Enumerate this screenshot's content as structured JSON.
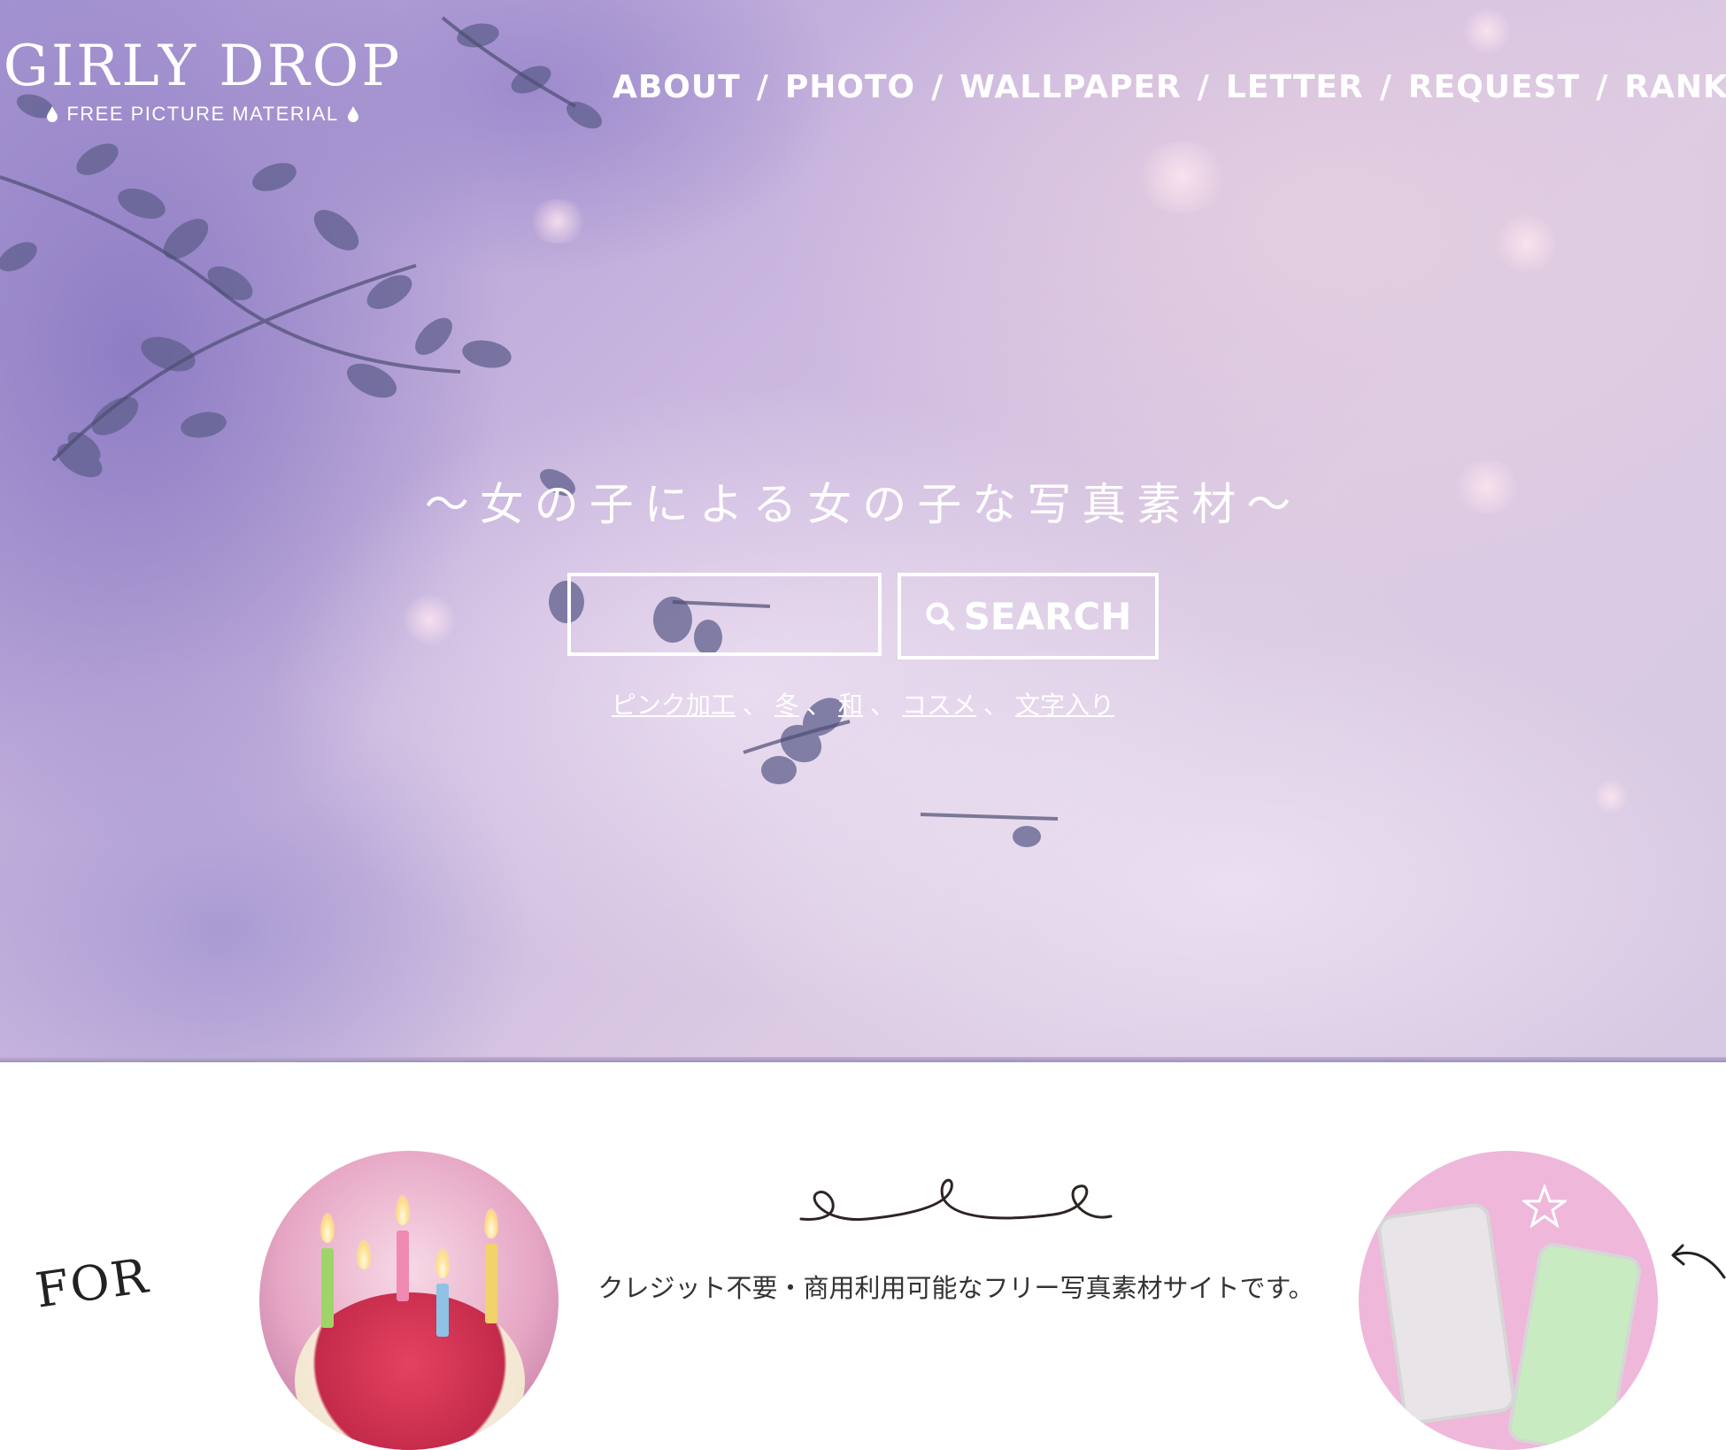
{
  "logo": {
    "title": "GIRLY DROP",
    "subtitle": "FREE PICTURE MATERIAL"
  },
  "nav": {
    "items": [
      "ABOUT",
      "PHOTO",
      "WALLPAPER",
      "LETTER",
      "REQUEST",
      "RANKING"
    ],
    "separator": "/"
  },
  "hero": {
    "tagline": "～女の子による女の子な写真素材～"
  },
  "search": {
    "value": "",
    "button_label": "SEARCH"
  },
  "keywords": {
    "items": [
      "ピンク加工",
      "冬",
      "和",
      "コスメ",
      "文字入り"
    ],
    "separator": "、"
  },
  "intro": {
    "text": "クレジット不要・商用利用可能なフリー写真素材サイトです。",
    "for_text": "FOR"
  },
  "icons": {
    "search": "search-icon",
    "drop": "drop-icon",
    "arrow": "curved-arrow-icon"
  },
  "colors": {
    "hero_primary": "#b9a6dc",
    "text_on_hero": "#ffffff",
    "body_text": "#333333"
  }
}
